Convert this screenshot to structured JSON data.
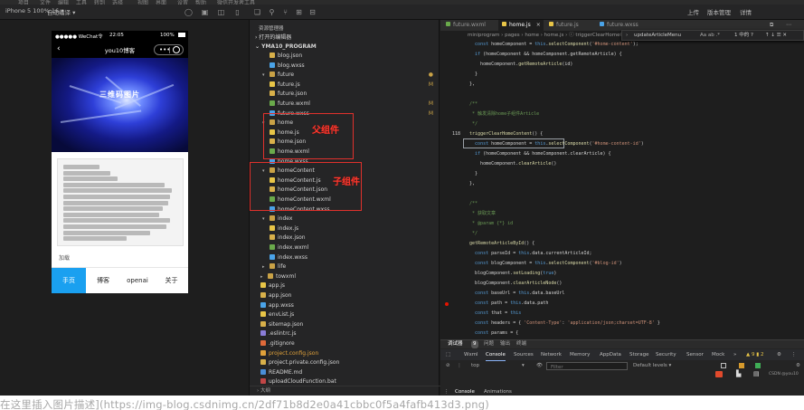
{
  "menu": [
    "项目",
    "文件",
    "编辑",
    "工具",
    "转到",
    "选择",
    "视图",
    "界面",
    "设置",
    "帮助",
    "微信开发者工具"
  ],
  "toolbar": {
    "device": "iPhone 5 100% 16 ▾",
    "auto_compile": "自动编译 ▾",
    "right_labels": [
      "上传",
      "版本管理",
      "详情"
    ]
  },
  "phone": {
    "carrier": "●●●●● WeChat令",
    "time": "22:05",
    "battery": "100%",
    "nav_title": "you10博客",
    "banner_text": "三维码图片",
    "more_text": "加载",
    "tabs": [
      "手页",
      "博客",
      "openai",
      "关于"
    ],
    "active_tab": 0
  },
  "explorer": {
    "header": "资源管理器",
    "open_editors": "› 打开的编辑器",
    "project": "⌄ YMA10_PROGRAM",
    "items": [
      {
        "name": "blog.json",
        "kind": "json",
        "level": 3,
        "mod": ""
      },
      {
        "name": "blog.wxss",
        "kind": "wxss",
        "level": 3,
        "mod": ""
      },
      {
        "name": "future",
        "kind": "folder",
        "level": 2,
        "mod": "●"
      },
      {
        "name": "future.js",
        "kind": "js",
        "level": 3,
        "mod": "M"
      },
      {
        "name": "future.json",
        "kind": "json",
        "level": 3,
        "mod": ""
      },
      {
        "name": "future.wxml",
        "kind": "wxml",
        "level": 3,
        "mod": "M"
      },
      {
        "name": "future.wxss",
        "kind": "wxss",
        "level": 3,
        "mod": "M"
      },
      {
        "name": "home",
        "kind": "folder",
        "level": 2,
        "mod": ""
      },
      {
        "name": "home.js",
        "kind": "js",
        "level": 3,
        "mod": ""
      },
      {
        "name": "home.json",
        "kind": "json",
        "level": 3,
        "mod": ""
      },
      {
        "name": "home.wxml",
        "kind": "wxml",
        "level": 3,
        "mod": ""
      },
      {
        "name": "home.wxss",
        "kind": "wxss",
        "level": 3,
        "mod": ""
      },
      {
        "name": "homeContent",
        "kind": "folder",
        "level": 2,
        "mod": ""
      },
      {
        "name": "homeContent.js",
        "kind": "js",
        "level": 3,
        "mod": ""
      },
      {
        "name": "homeContent.json",
        "kind": "json",
        "level": 3,
        "mod": ""
      },
      {
        "name": "homeContent.wxml",
        "kind": "wxml",
        "level": 3,
        "mod": ""
      },
      {
        "name": "homeContent.wxss",
        "kind": "wxss",
        "level": 3,
        "mod": ""
      },
      {
        "name": "index",
        "kind": "folder",
        "level": 2,
        "mod": ""
      },
      {
        "name": "index.js",
        "kind": "js",
        "level": 3,
        "mod": ""
      },
      {
        "name": "index.json",
        "kind": "json",
        "level": 3,
        "mod": ""
      },
      {
        "name": "index.wxml",
        "kind": "wxml",
        "level": 3,
        "mod": ""
      },
      {
        "name": "index.wxss",
        "kind": "wxss",
        "level": 3,
        "mod": ""
      },
      {
        "name": "life",
        "kind": "folder-closed",
        "level": 2,
        "mod": ""
      },
      {
        "name": "towxml",
        "kind": "folder-closed",
        "level": 1,
        "mod": ""
      },
      {
        "name": "app.js",
        "kind": "js",
        "level": 1,
        "mod": ""
      },
      {
        "name": "app.json",
        "kind": "json",
        "level": 1,
        "mod": ""
      },
      {
        "name": "app.wxss",
        "kind": "wxss",
        "level": 1,
        "mod": ""
      },
      {
        "name": "envList.js",
        "kind": "js",
        "level": 1,
        "mod": ""
      },
      {
        "name": "sitemap.json",
        "kind": "json",
        "level": 1,
        "mod": ""
      },
      {
        "name": ".eslintrc.js",
        "kind": "eslint",
        "level": 1,
        "mod": ""
      },
      {
        "name": ".gitignore",
        "kind": "git",
        "level": 1,
        "mod": ""
      },
      {
        "name": "project.config.json",
        "kind": "json-mod",
        "level": 1,
        "mod": ""
      },
      {
        "name": "project.private.config.json",
        "kind": "json",
        "level": 1,
        "mod": ""
      },
      {
        "name": "README.md",
        "kind": "md",
        "level": 1,
        "mod": ""
      },
      {
        "name": "uploadCloudFunction.bat",
        "kind": "bat",
        "level": 1,
        "mod": ""
      }
    ],
    "annotations": {
      "parent": "父组件",
      "child": "子组件"
    },
    "bottom": "› 大纲"
  },
  "editor": {
    "tabs": [
      {
        "label": "future.wxml",
        "kind": "wxml",
        "active": false
      },
      {
        "label": "home.js",
        "kind": "js",
        "active": true
      },
      {
        "label": "future.js",
        "kind": "js",
        "active": false
      },
      {
        "label": "future.wxss",
        "kind": "wxss",
        "active": false
      }
    ],
    "breadcrumb": "miniprogram › pages › home › home.js › ⓘ triggerClearHomeContent",
    "find": {
      "query": "updateArticleMenu",
      "opts": "Aa  ab  .*",
      "result": "1 中的 ?",
      "arrows": "↑  ↓  ☰  ✕"
    },
    "lines": [
      {
        "n": "",
        "t": "    const homeComponent = this.selectComponent('#home-content');"
      },
      {
        "n": "",
        "t": "    if (homeComponent && homeComponent.getRemoteArticle) {"
      },
      {
        "n": "",
        "t": "      homeComponent.getRemoteArticle(id)"
      },
      {
        "n": "",
        "t": "    }"
      },
      {
        "n": "",
        "t": "  },"
      },
      {
        "n": "",
        "t": ""
      },
      {
        "n": "",
        "t": "  /**"
      },
      {
        "n": "",
        "t": "   * 触发清除home子组件Article"
      },
      {
        "n": "",
        "t": "   */"
      },
      {
        "n": "118",
        "t": "  triggerClearHomeContent() {"
      },
      {
        "n": "",
        "t": "    const homeComponent = this.selectComponent('#home-content-id')"
      },
      {
        "n": "",
        "t": "    if (homeComponent && homeComponent.clearArticle) {"
      },
      {
        "n": "",
        "t": "      homeComponent.clearArticle()"
      },
      {
        "n": "",
        "t": "    }"
      },
      {
        "n": "",
        "t": "  },"
      },
      {
        "n": "",
        "t": ""
      },
      {
        "n": "",
        "t": "  /**"
      },
      {
        "n": "",
        "t": "   * 获取文章"
      },
      {
        "n": "",
        "t": "   * @param {*} id"
      },
      {
        "n": "",
        "t": "   */"
      },
      {
        "n": "",
        "t": "  getRemoteArticleById() {"
      },
      {
        "n": "",
        "t": "    const parseId = this.data.currentArticleId;"
      },
      {
        "n": "",
        "t": "    const blogComponent = this.selectComponent('#blog-id')"
      },
      {
        "n": "",
        "t": "    blogComponent.setLoading(true)"
      },
      {
        "n": "",
        "t": "    blogComponent.clearArticleNode()"
      },
      {
        "n": "",
        "t": "    const baseUrl = this.data.baseUrl"
      },
      {
        "n": "",
        "t": "    const path = this.data.path"
      },
      {
        "n": "",
        "t": "    const that = this"
      },
      {
        "n": "",
        "t": "    const headers = { 'Content-Type': 'application/json;charset=UTF-8' }"
      },
      {
        "n": "",
        "t": "    const params = {"
      }
    ]
  },
  "devtools": {
    "top_tabs": [
      "调试器",
      "9",
      "问题",
      "输出",
      "终端"
    ],
    "tabs": [
      "Wxml",
      "Console",
      "Sources",
      "Network",
      "Memory",
      "AppData",
      "Storage",
      "Security",
      "Sensor",
      "Mock",
      "»"
    ],
    "active_tab": "Console",
    "warn_count": "▲ 9  ▮ 2",
    "context": "top",
    "filter_placeholder": "Filter",
    "levels": "Default levels ▾",
    "bottom_tabs": [
      "Console",
      "Animations"
    ],
    "watermark": "CSDN @you10"
  },
  "caption": "在这里插入图片描述](https://img-blog.csdnimg.cn/2df71b8d2e0a41cbbc0f5a4fafb413d3.png)",
  "colors": {
    "js": "#e8c547",
    "json": "#d8b04a",
    "wxml": "#6aaa4b",
    "wxss": "#4aa3e8",
    "folder": "#c9a246",
    "annotation": "#ff3a2f",
    "active_tab": "#1aa0f0"
  }
}
